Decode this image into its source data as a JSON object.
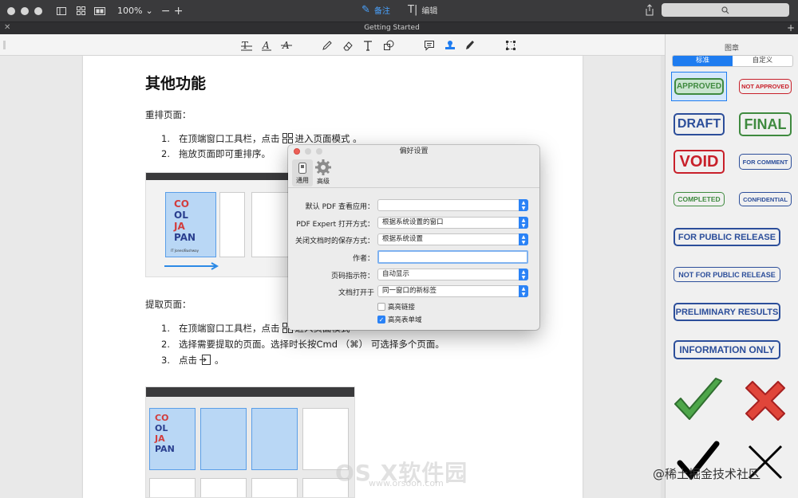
{
  "window": {
    "zoom": "100%",
    "mode_annotate": "备注",
    "mode_edit": "编辑",
    "tab_title": "Getting Started"
  },
  "document": {
    "heading": "其他功能",
    "section1_title": "重排页面：",
    "section1_items": [
      {
        "num": "1.",
        "before": "在顶端窗口工具栏，点击",
        "after": "进入页面模式 。"
      },
      {
        "num": "2.",
        "text": "拖放页面即可重排序。"
      }
    ],
    "section2_title": "提取页面：",
    "section2_items": [
      {
        "num": "1.",
        "before": "在顶端窗口工具栏，点击",
        "after": "进入页面模式"
      },
      {
        "num": "2.",
        "text": "选择需要提取的页面。选择时长按Cmd （⌘） 可选择多个页面。"
      },
      {
        "num": "3.",
        "before": "点击",
        "after": "。"
      }
    ],
    "thumb_logo_lines": [
      "CO",
      "OL",
      "JA",
      "PAN"
    ],
    "thumb_caption": "IT Jones/Bushway"
  },
  "watermark": {
    "cn": "OS X软件园",
    "url": "www.orsoon.com",
    "juejin": "@稀土掘金技术社区"
  },
  "stamps_panel": {
    "title": "图章",
    "tab_standard": "标准",
    "tab_custom": "自定义",
    "stamps": [
      "APPROVED",
      "NOT APPROVED",
      "DRAFT",
      "FINAL",
      "VOID",
      "FOR COMMENT",
      "COMPLETED",
      "CONFIDENTIAL",
      "FOR PUBLIC RELEASE",
      "NOT FOR PUBLIC RELEASE",
      "PRELIMINARY RESULTS",
      "INFORMATION ONLY"
    ],
    "colors": {
      "green": "#3f8a3f",
      "red": "#c8202a",
      "blue": "#2c4e9a"
    }
  },
  "dialog": {
    "title": "偏好设置",
    "tab_general": "通用",
    "tab_advanced": "高级",
    "rows": [
      {
        "label": "默认 PDF 查看应用：",
        "value": ""
      },
      {
        "label": "PDF Expert 打开方式：",
        "value": "根据系统设置的窗口"
      },
      {
        "label": "关闭文档时的保存方式：",
        "value": "根据系统设置"
      },
      {
        "label": "作者：",
        "value": ""
      },
      {
        "label": "页码指示符：",
        "value": "自动显示"
      },
      {
        "label": "文档打开于",
        "value": "同一窗口的新标签"
      }
    ],
    "check_highlight_links": "高亮链接",
    "check_highlight_forms": "高亮表单域",
    "highlight_links_checked": false,
    "highlight_forms_checked": true
  }
}
